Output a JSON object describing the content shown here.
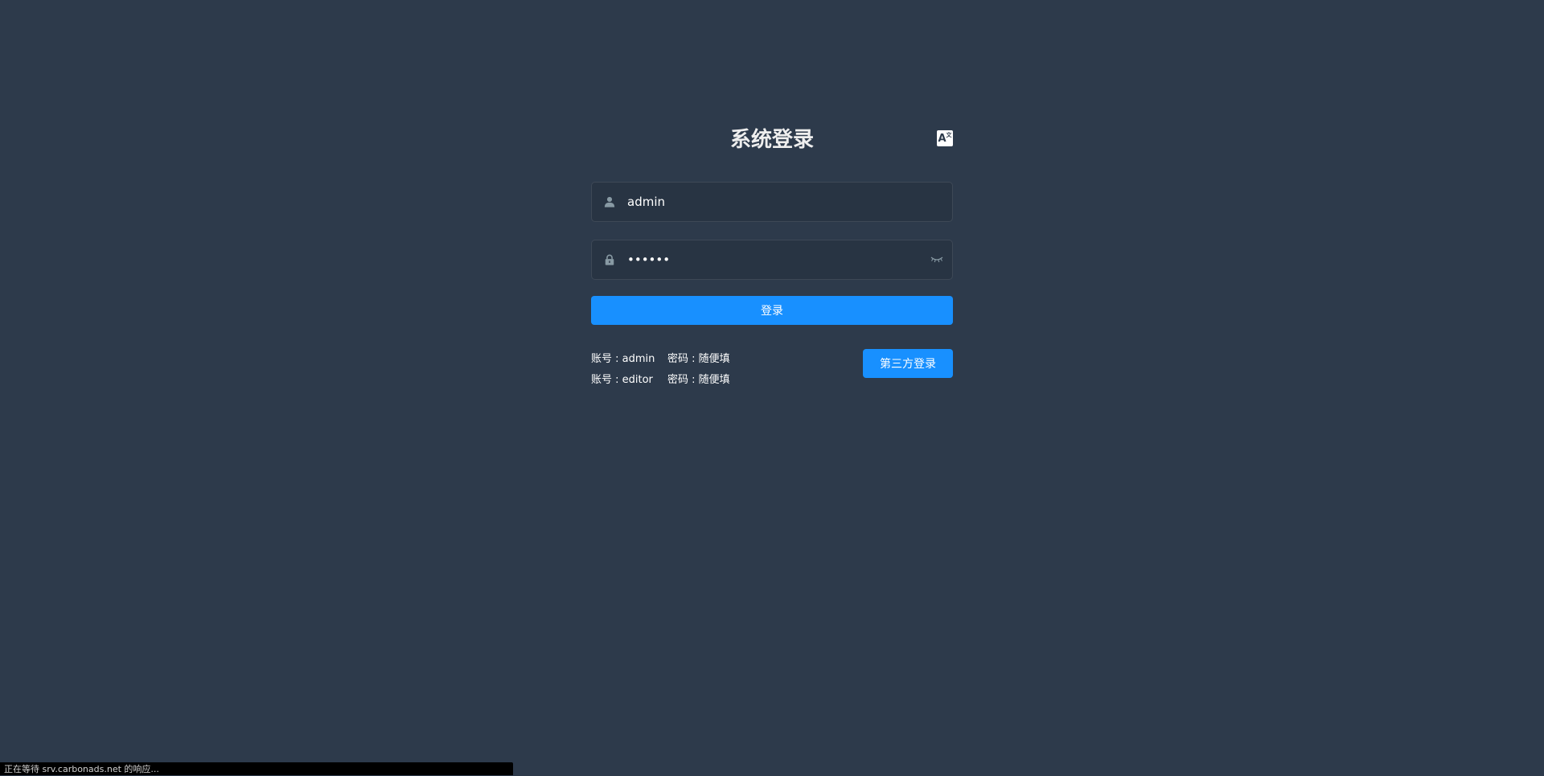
{
  "login": {
    "title": "系统登录",
    "lang_icon": "translate-icon",
    "username": {
      "icon": "user-icon",
      "value": "admin"
    },
    "password": {
      "icon": "lock-icon",
      "value": "••••••",
      "toggle_icon": "eye-closed-icon"
    },
    "login_button": "登录",
    "tips": [
      {
        "account": "账号 : admin",
        "password": "密码 : 随便填"
      },
      {
        "account": "账号 : editor",
        "password": "密码 : 随便填"
      }
    ],
    "third_party_button": "第三方登录"
  },
  "status_bar": {
    "text": "正在等待 srv.carbonads.net 的响应..."
  },
  "colors": {
    "background": "#2d3a4b",
    "primary": "#1890ff",
    "icon": "#889aa4"
  }
}
